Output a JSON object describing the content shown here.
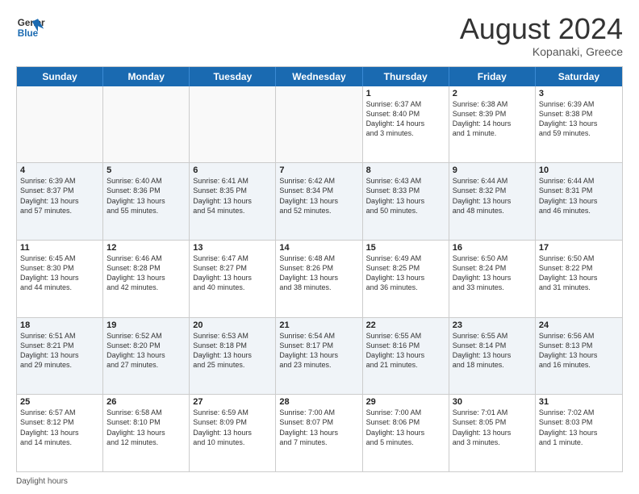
{
  "header": {
    "logo_line1": "General",
    "logo_line2": "Blue",
    "month_title": "August 2024",
    "location": "Kopanaki, Greece"
  },
  "weekdays": [
    "Sunday",
    "Monday",
    "Tuesday",
    "Wednesday",
    "Thursday",
    "Friday",
    "Saturday"
  ],
  "footer_label": "Daylight hours",
  "weeks": [
    [
      {
        "day": "",
        "info": ""
      },
      {
        "day": "",
        "info": ""
      },
      {
        "day": "",
        "info": ""
      },
      {
        "day": "",
        "info": ""
      },
      {
        "day": "1",
        "info": "Sunrise: 6:37 AM\nSunset: 8:40 PM\nDaylight: 14 hours\nand 3 minutes."
      },
      {
        "day": "2",
        "info": "Sunrise: 6:38 AM\nSunset: 8:39 PM\nDaylight: 14 hours\nand 1 minute."
      },
      {
        "day": "3",
        "info": "Sunrise: 6:39 AM\nSunset: 8:38 PM\nDaylight: 13 hours\nand 59 minutes."
      }
    ],
    [
      {
        "day": "4",
        "info": "Sunrise: 6:39 AM\nSunset: 8:37 PM\nDaylight: 13 hours\nand 57 minutes."
      },
      {
        "day": "5",
        "info": "Sunrise: 6:40 AM\nSunset: 8:36 PM\nDaylight: 13 hours\nand 55 minutes."
      },
      {
        "day": "6",
        "info": "Sunrise: 6:41 AM\nSunset: 8:35 PM\nDaylight: 13 hours\nand 54 minutes."
      },
      {
        "day": "7",
        "info": "Sunrise: 6:42 AM\nSunset: 8:34 PM\nDaylight: 13 hours\nand 52 minutes."
      },
      {
        "day": "8",
        "info": "Sunrise: 6:43 AM\nSunset: 8:33 PM\nDaylight: 13 hours\nand 50 minutes."
      },
      {
        "day": "9",
        "info": "Sunrise: 6:44 AM\nSunset: 8:32 PM\nDaylight: 13 hours\nand 48 minutes."
      },
      {
        "day": "10",
        "info": "Sunrise: 6:44 AM\nSunset: 8:31 PM\nDaylight: 13 hours\nand 46 minutes."
      }
    ],
    [
      {
        "day": "11",
        "info": "Sunrise: 6:45 AM\nSunset: 8:30 PM\nDaylight: 13 hours\nand 44 minutes."
      },
      {
        "day": "12",
        "info": "Sunrise: 6:46 AM\nSunset: 8:28 PM\nDaylight: 13 hours\nand 42 minutes."
      },
      {
        "day": "13",
        "info": "Sunrise: 6:47 AM\nSunset: 8:27 PM\nDaylight: 13 hours\nand 40 minutes."
      },
      {
        "day": "14",
        "info": "Sunrise: 6:48 AM\nSunset: 8:26 PM\nDaylight: 13 hours\nand 38 minutes."
      },
      {
        "day": "15",
        "info": "Sunrise: 6:49 AM\nSunset: 8:25 PM\nDaylight: 13 hours\nand 36 minutes."
      },
      {
        "day": "16",
        "info": "Sunrise: 6:50 AM\nSunset: 8:24 PM\nDaylight: 13 hours\nand 33 minutes."
      },
      {
        "day": "17",
        "info": "Sunrise: 6:50 AM\nSunset: 8:22 PM\nDaylight: 13 hours\nand 31 minutes."
      }
    ],
    [
      {
        "day": "18",
        "info": "Sunrise: 6:51 AM\nSunset: 8:21 PM\nDaylight: 13 hours\nand 29 minutes."
      },
      {
        "day": "19",
        "info": "Sunrise: 6:52 AM\nSunset: 8:20 PM\nDaylight: 13 hours\nand 27 minutes."
      },
      {
        "day": "20",
        "info": "Sunrise: 6:53 AM\nSunset: 8:18 PM\nDaylight: 13 hours\nand 25 minutes."
      },
      {
        "day": "21",
        "info": "Sunrise: 6:54 AM\nSunset: 8:17 PM\nDaylight: 13 hours\nand 23 minutes."
      },
      {
        "day": "22",
        "info": "Sunrise: 6:55 AM\nSunset: 8:16 PM\nDaylight: 13 hours\nand 21 minutes."
      },
      {
        "day": "23",
        "info": "Sunrise: 6:55 AM\nSunset: 8:14 PM\nDaylight: 13 hours\nand 18 minutes."
      },
      {
        "day": "24",
        "info": "Sunrise: 6:56 AM\nSunset: 8:13 PM\nDaylight: 13 hours\nand 16 minutes."
      }
    ],
    [
      {
        "day": "25",
        "info": "Sunrise: 6:57 AM\nSunset: 8:12 PM\nDaylight: 13 hours\nand 14 minutes."
      },
      {
        "day": "26",
        "info": "Sunrise: 6:58 AM\nSunset: 8:10 PM\nDaylight: 13 hours\nand 12 minutes."
      },
      {
        "day": "27",
        "info": "Sunrise: 6:59 AM\nSunset: 8:09 PM\nDaylight: 13 hours\nand 10 minutes."
      },
      {
        "day": "28",
        "info": "Sunrise: 7:00 AM\nSunset: 8:07 PM\nDaylight: 13 hours\nand 7 minutes."
      },
      {
        "day": "29",
        "info": "Sunrise: 7:00 AM\nSunset: 8:06 PM\nDaylight: 13 hours\nand 5 minutes."
      },
      {
        "day": "30",
        "info": "Sunrise: 7:01 AM\nSunset: 8:05 PM\nDaylight: 13 hours\nand 3 minutes."
      },
      {
        "day": "31",
        "info": "Sunrise: 7:02 AM\nSunset: 8:03 PM\nDaylight: 13 hours\nand 1 minute."
      }
    ]
  ]
}
